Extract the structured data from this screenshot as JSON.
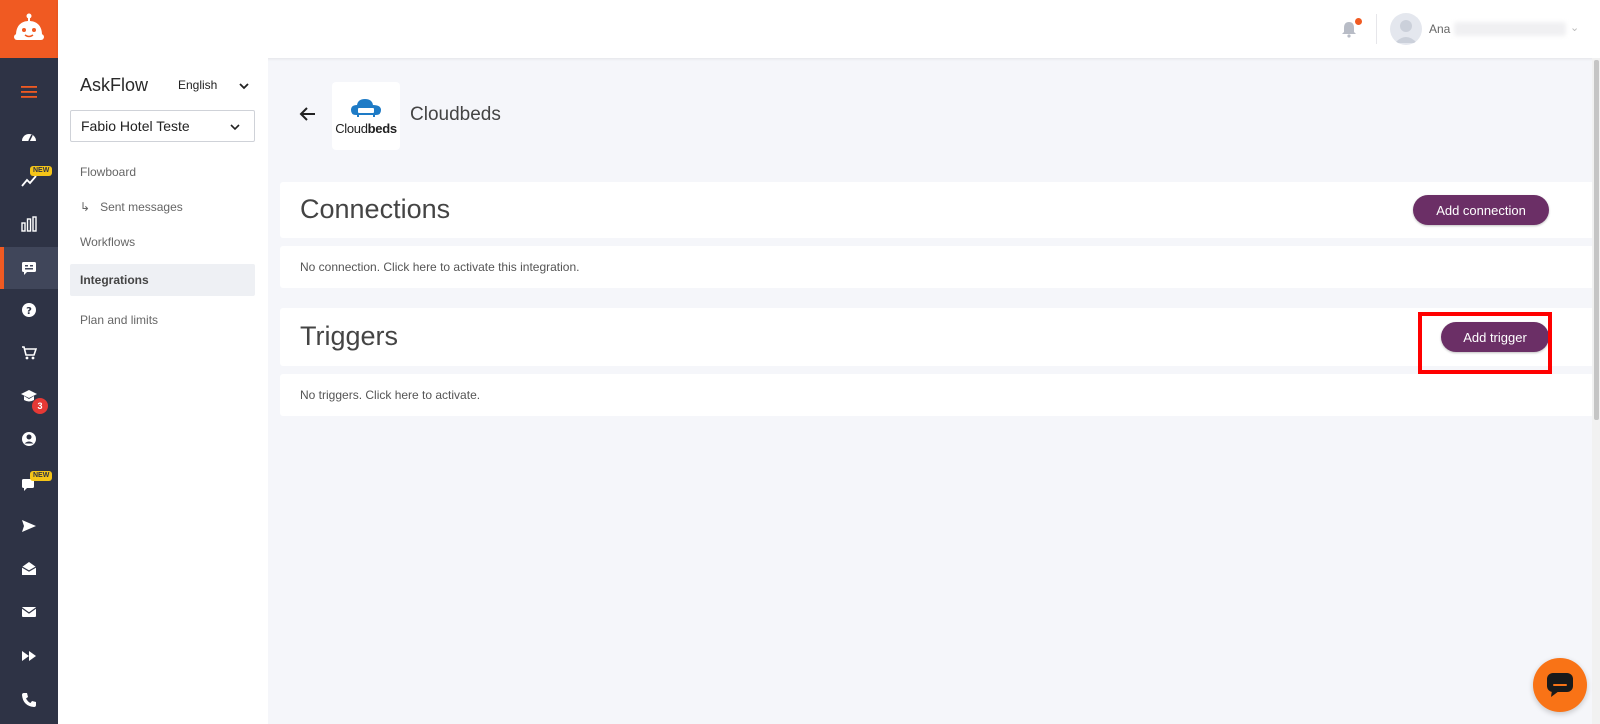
{
  "app": {
    "brand_color": "#f05a22",
    "accent_color": "#6b2f66",
    "rail_color": "#2e3345"
  },
  "rail": {
    "items": [
      {
        "icon": "hamburger-menu-icon"
      },
      {
        "icon": "dashboard-gauge-icon"
      },
      {
        "icon": "trending-chart-icon",
        "badge": "NEW"
      },
      {
        "icon": "bar-chart-icon"
      },
      {
        "icon": "chatbot-flow-icon",
        "active": true
      },
      {
        "icon": "help-circle-icon"
      },
      {
        "icon": "cart-icon"
      },
      {
        "icon": "graduation-cap-icon",
        "count": "3"
      },
      {
        "icon": "account-circle-icon"
      },
      {
        "icon": "chat-bubble-icon",
        "badge": "NEW"
      },
      {
        "icon": "send-icon"
      },
      {
        "icon": "mail-open-icon"
      },
      {
        "icon": "mail-icon"
      },
      {
        "icon": "fast-forward-icon"
      },
      {
        "icon": "phone-icon"
      }
    ]
  },
  "topbar": {
    "user_name": "Ana"
  },
  "sidebar": {
    "brand": "AskFlow",
    "language": "English",
    "hotel": "Fabio Hotel Teste",
    "nav": {
      "flowboard": "Flowboard",
      "sent_messages": "Sent messages",
      "workflows": "Workflows",
      "integrations": "Integrations",
      "plan_and_limits": "Plan and limits"
    }
  },
  "integration": {
    "name": "Cloudbeds",
    "logo_text_light": "Cloud",
    "logo_text_bold": "beds"
  },
  "connections": {
    "title": "Connections",
    "add_label": "Add connection",
    "empty_text": "No connection. Click here to activate this integration."
  },
  "triggers": {
    "title": "Triggers",
    "add_label": "Add trigger",
    "empty_text": "No triggers. Click here to activate."
  }
}
